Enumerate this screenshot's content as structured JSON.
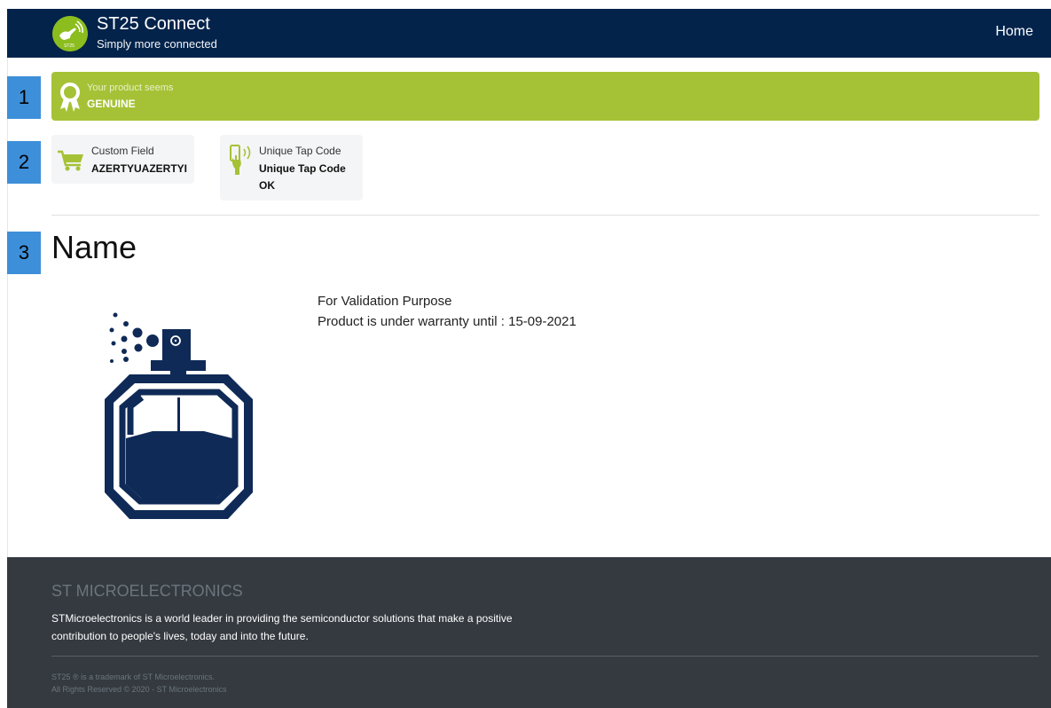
{
  "header": {
    "app_title": "ST25 Connect",
    "tagline": "Simply more connected",
    "nav_home": "Home",
    "logo_text": "ST25"
  },
  "steps": [
    "1",
    "2",
    "3"
  ],
  "authenticity": {
    "subtitle": "Your product seems",
    "status": "GENUINE",
    "icon": "award-ribbon-icon",
    "color": "#a5c236"
  },
  "cards": [
    {
      "label": "Custom Field",
      "value": "AZERTYUAZERTYI",
      "icon": "shopping-cart-icon"
    },
    {
      "label": "Unique Tap Code",
      "value_line1": "Unique Tap Code",
      "value_line2": "OK",
      "icon": "phone-tap-icon"
    }
  ],
  "product": {
    "name": "Name",
    "line1": "For Validation Purpose",
    "line2": "Product is under warranty until : 15-09-2021",
    "image": "perfume-bottle-icon"
  },
  "footer": {
    "title": "ST MICROELECTRONICS",
    "description": "STMicroelectronics is a world leader in providing the semiconductor solutions that make a positive contribution to people's lives, today and into the future.",
    "trademark": "ST25 ® is a trademark of ST Microelectronics.",
    "copyright": "All Rights Reserved © 2020 - ST Microelectronics"
  },
  "colors": {
    "header_bg": "#03234b",
    "accent_green": "#a5c236",
    "step_blue": "#3d8fd9",
    "footer_bg": "#343a40",
    "icon_navy": "#0f2a56"
  }
}
